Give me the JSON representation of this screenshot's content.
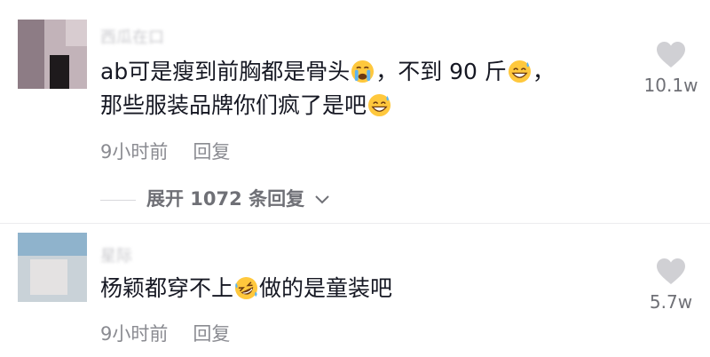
{
  "comments": [
    {
      "username": "西瓜在口",
      "text_parts": [
        "ab可是瘦到前胸都是骨头",
        "，不到 90 斤",
        "，",
        "那些服装品牌你们疯了是吧"
      ],
      "emojis": [
        "crying-face",
        "grinning-sweat-face",
        "grinning-sweat-face"
      ],
      "time": "9小时前",
      "reply_label": "回复",
      "likes": "10.1w",
      "expand_label": "展开 1072 条回复"
    },
    {
      "username": "星际",
      "text_parts": [
        "杨颖都穿不上",
        "做的是童装吧"
      ],
      "emojis": [
        "rolling-laughing-face"
      ],
      "time": "9小时前",
      "reply_label": "回复",
      "likes": "5.7w"
    }
  ],
  "colors": {
    "text": "#161823",
    "meta": "#8a8b91",
    "heart": "#d0d0d4",
    "emoji": "#ffc83d"
  }
}
